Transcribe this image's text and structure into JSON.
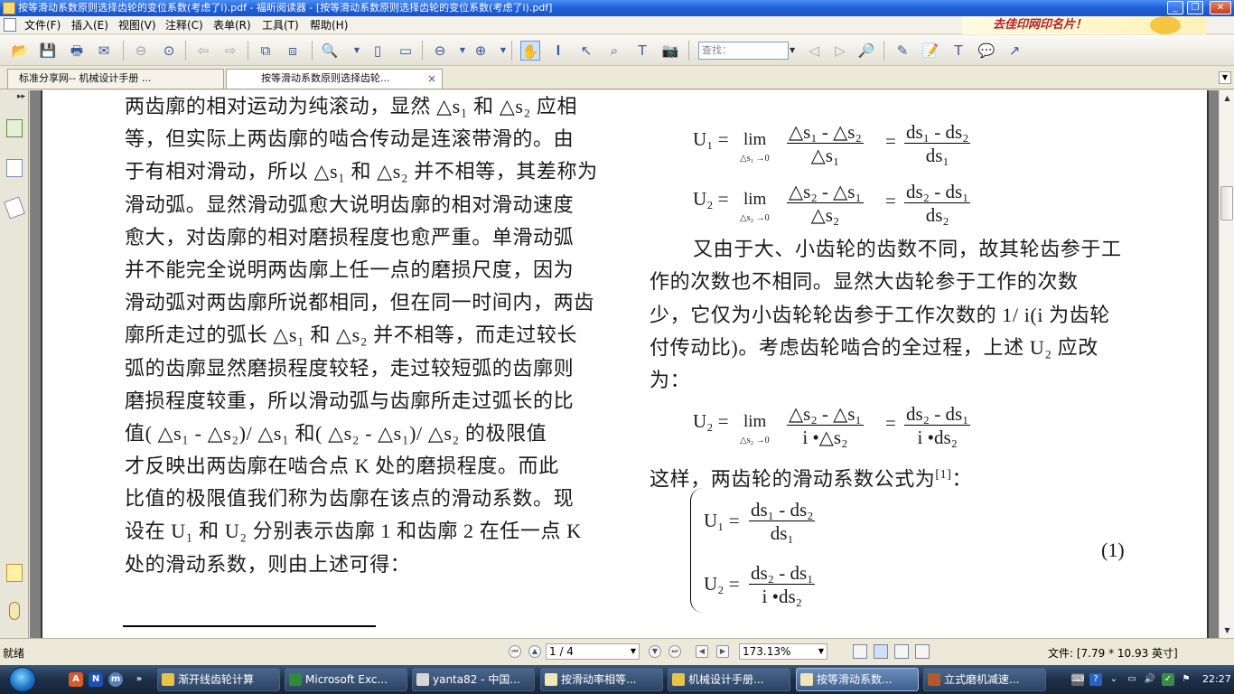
{
  "window": {
    "title": "按等滑动系数原则选择齿轮的变位系数(考虑了i).pdf - 福昕阅读器 - [按等滑动系数原则选择齿轮的变位系数(考虑了i).pdf]"
  },
  "menu": {
    "items": [
      "文件(F)",
      "插入(E)",
      "视图(V)",
      "注释(C)",
      "表单(R)",
      "工具(T)",
      "帮助(H)"
    ]
  },
  "ad": {
    "text": "去佳印网印名片！"
  },
  "toolbar": {
    "search_placeholder": "查找："
  },
  "tabs": [
    {
      "label": "标准分享网-- 机械设计手册 ...",
      "active": false
    },
    {
      "label": "按等滑动系数原则选择齿轮...",
      "active": true,
      "close": "×"
    }
  ],
  "document": {
    "left_lines": [
      "两齿廓的相对运动为纯滚动，显然 △s₁ 和 △s₂ 应相",
      "等，但实际上两齿廓的啮合传动是连滚带滑的。由",
      "于有相对滑动，所以 △s₁ 和 △s₂ 并不相等，其差称为",
      "滑动弧。显然滑动弧愈大说明齿廓的相对滑动速度",
      "愈大，对齿廓的相对磨损程度也愈严重。单滑动弧",
      "并不能完全说明两齿廓上任一点的磨损尺度，因为",
      "滑动弧对两齿廓所说都相同，但在同一时间内，两齿",
      "廓所走过的弧长 △s₁ 和 △s₂ 并不相等，而走过较长",
      "弧的齿廓显然磨损程度较轻，走过较短弧的齿廓则",
      "磨损程度较重，所以滑动弧与齿廓所走过弧长的比",
      "值( △s₁ -  △s₂)/  △s₁ 和( △s₂ -  △s₁)/  △s₂ 的极限值",
      "才反映出两齿廓在啮合点 K 处的磨损程度。而此",
      "比值的极限值我们称为齿廓在该点的滑动系数。现",
      "设在 U₁ 和 U₂ 分别表示齿廓 1 和齿廓 2 在任一点 K",
      "处的滑动系数，则由上述可得："
    ],
    "eq1": {
      "lhs": "U₁ =",
      "lim": "lim",
      "lim_sub": "△s₁ →0",
      "num": "△s₁ -  △s₂",
      "den": "△s₁",
      "eq": "=",
      "num2": "ds₁ - ds₂",
      "den2": "ds₁"
    },
    "eq2": {
      "lhs": "U₂ =",
      "lim": "lim",
      "lim_sub": "△s₂ →0",
      "num": "△s₂ -  △s₁",
      "den": "△s₂",
      "eq": "=",
      "num2": "ds₂ - ds₁",
      "den2": "ds₂"
    },
    "right_lines": [
      "又由于大、小齿轮的齿数不同，故其轮齿参于工",
      "作的次数也不相同。显然大齿轮参于工作的次数",
      "少，它仅为小齿轮轮齿参于工作次数的 1/ i(i 为齿轮",
      "付传动比)。考虑齿轮啮合的全过程，上述 U₂ 应改",
      "为："
    ],
    "eq3": {
      "lhs": "U₂ =",
      "lim": "lim",
      "lim_sub": "△s₂ →0",
      "num": "△s₂ -  △s₁",
      "den": "i •△s₂",
      "eq": "=",
      "num2": "ds₂ - ds₁",
      "den2": "i •ds₂"
    },
    "slide_intro": "这样，两齿轮的滑动系数公式为",
    "slide_ref": "[1]",
    "slide_colon": "：",
    "sys1": {
      "lhs": "U₁ =",
      "num": "ds₁ -  ds₂",
      "den": "ds₁"
    },
    "sys2": {
      "lhs": "U₂ =",
      "num": "ds₂ -  ds₁",
      "den": "i •ds₂"
    },
    "eq_number": "(1)"
  },
  "status": {
    "ready": "就绪",
    "page": "1 / 4",
    "zoom": "173.13%",
    "file_size": "文件: [7.79 * 10.93 英寸]"
  },
  "taskbar": {
    "tasks": [
      {
        "label": "渐开线齿轮计算",
        "color": "#e8c34a"
      },
      {
        "label": "Microsoft Exc...",
        "color": "#2f8a3e"
      },
      {
        "label": "yanta82 - 中国...",
        "color": "#d6d6d6"
      },
      {
        "label": "按滑动率相等...",
        "color": "#f0e6b5"
      },
      {
        "label": "机械设计手册...",
        "color": "#e8c34a"
      },
      {
        "label": "按等滑动系数...",
        "color": "#f0e6b5",
        "active": true
      },
      {
        "label": "立式磨机减速...",
        "color": "#b35a2a"
      }
    ],
    "clock": "22:27"
  }
}
